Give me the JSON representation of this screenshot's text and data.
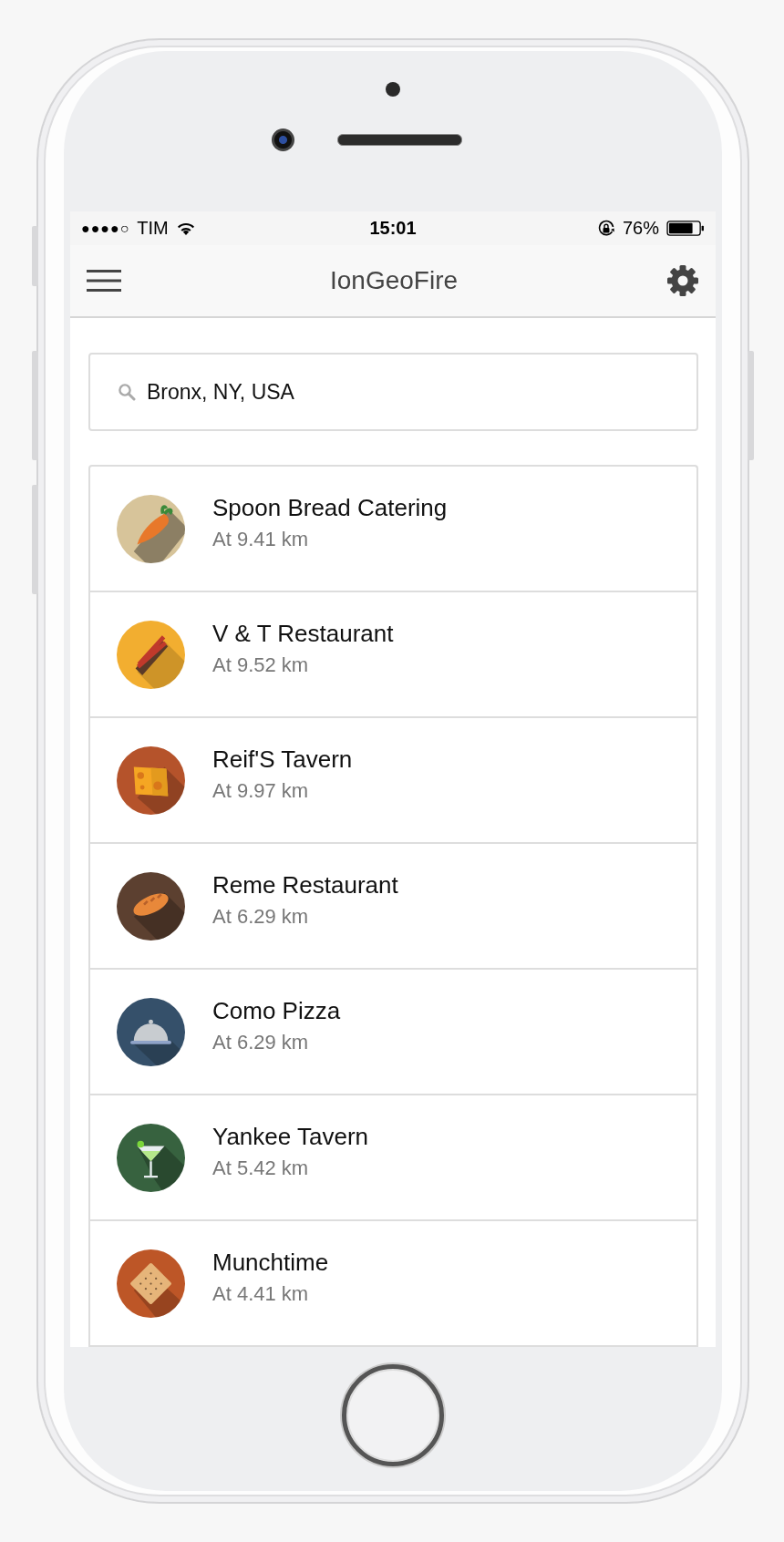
{
  "status_bar": {
    "signal": "●●●●○",
    "carrier": "TIM",
    "time": "15:01",
    "battery": "76%"
  },
  "header": {
    "title": "IonGeoFire"
  },
  "search": {
    "value": "Bronx, NY, USA"
  },
  "places": [
    {
      "name": "Spoon Bread Catering",
      "distance": "At 9.41 km",
      "color": "#d7c49a"
    },
    {
      "name": "V & T Restaurant",
      "distance": "At 9.52 km",
      "color": "#f2ae30"
    },
    {
      "name": "Reif'S Tavern",
      "distance": "At 9.97 km",
      "color": "#b5532b"
    },
    {
      "name": "Reme Restaurant",
      "distance": "At 6.29 km",
      "color": "#5c4030"
    },
    {
      "name": "Como Pizza",
      "distance": "At 6.29 km",
      "color": "#35506a"
    },
    {
      "name": "Yankee Tavern",
      "distance": "At 5.42 km",
      "color": "#37623f"
    },
    {
      "name": "Munchtime",
      "distance": "At 4.41 km",
      "color": "#bd5627"
    }
  ]
}
